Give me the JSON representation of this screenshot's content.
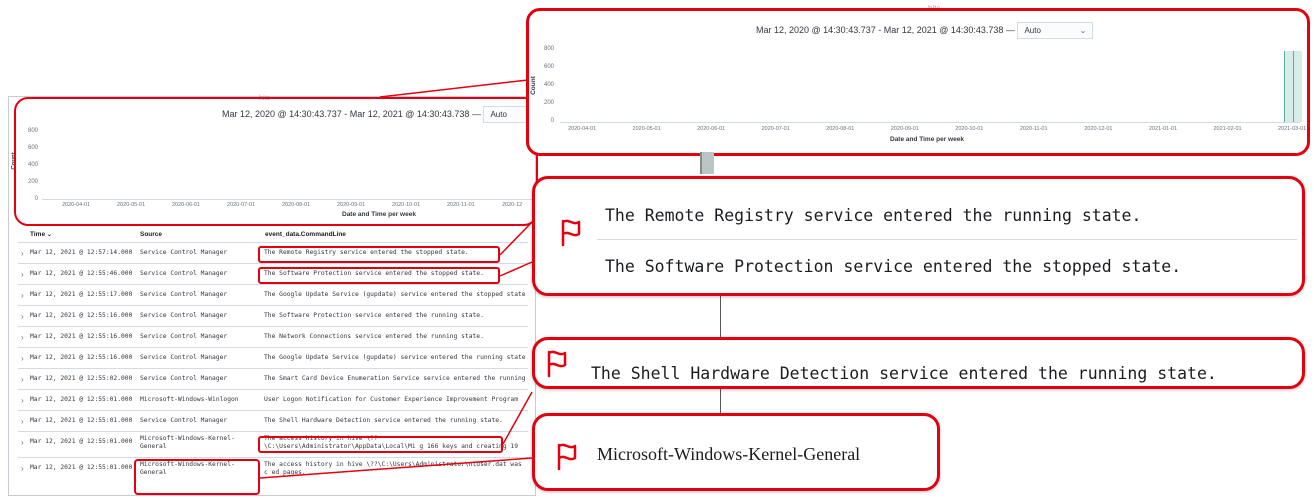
{
  "date_range": {
    "text": "Mar 12, 2020 @ 14:30:43.737 - Mar 12, 2021 @ 14:30:43.738 —",
    "interval": "Auto"
  },
  "chart_label_top": "hits",
  "chart_data": {
    "type": "bar",
    "xlabel": "Date and Time per week",
    "ylabel": "Count",
    "ylim": [
      0,
      800
    ],
    "y_ticks": [
      "800",
      "600",
      "400",
      "200",
      "0"
    ],
    "x_ticks_large": [
      "2020-04-01",
      "2020-05-01",
      "2020-06-01",
      "2020-07-01",
      "2020-08-01",
      "2020-09-01",
      "2020-10-01",
      "2020-11-01",
      "2020-12-01",
      "2021-01-01",
      "2021-02-01",
      "2021-03-01"
    ],
    "x_ticks_small": [
      "2020-04-01",
      "2020-05-01",
      "2020-06-01",
      "2020-07-01",
      "2020-08-01",
      "2020-09-01",
      "2020-10-01",
      "2020-11-01",
      "2020-12"
    ],
    "categories": [
      "2021-03-08"
    ],
    "values": [
      730
    ],
    "grid": false,
    "colors": {
      "bar": "#d6ece8",
      "bar_edge": "#54b399"
    }
  },
  "table": {
    "columns": [
      "Time",
      "Source",
      "event_data.CommandLine"
    ],
    "sort_icon": "sort-down-icon",
    "rows": [
      {
        "time": "Mar 12, 2021 @ 12:57:14.000",
        "source": "Service Control Manager",
        "cmd": "The Remote Registry service entered the stopped state."
      },
      {
        "time": "Mar 12, 2021 @ 12:55:46.000",
        "source": "Service Control Manager",
        "cmd": "The Software Protection service entered the stopped state."
      },
      {
        "time": "Mar 12, 2021 @ 12:55:17.000",
        "source": "Service Control Manager",
        "cmd": "The Google Update Service (gupdate) service entered the stopped state"
      },
      {
        "time": "Mar 12, 2021 @ 12:55:16.000",
        "source": "Service Control Manager",
        "cmd": "The Software Protection service entered the running state."
      },
      {
        "time": "Mar 12, 2021 @ 12:55:16.000",
        "source": "Service Control Manager",
        "cmd": "The Network Connections service entered the running state."
      },
      {
        "time": "Mar 12, 2021 @ 12:55:16.000",
        "source": "Service Control Manager",
        "cmd": "The Google Update Service (gupdate) service entered the running state"
      },
      {
        "time": "Mar 12, 2021 @ 12:55:02.000",
        "source": "Service Control Manager",
        "cmd": "The Smart Card Device Enumeration Service service entered the running"
      },
      {
        "time": "Mar 12, 2021 @ 12:55:01.000",
        "source": "Microsoft-Windows-Winlogon",
        "cmd": "User Logon Notification for Customer Experience Improvement Program"
      },
      {
        "time": "Mar 12, 2021 @ 12:55:01.000",
        "source": "Service Control Manager",
        "cmd": "The Shell Hardware Detection service entered the running state."
      },
      {
        "time": "Mar 12, 2021 @ 12:55:01.000",
        "source": "Microsoft-Windows-Kernel-General",
        "cmd": "The access history in hive \\??\\C:\\Users\\Administrator\\AppData\\Local\\Mi g 166 keys and creating 19 modified pages."
      },
      {
        "time": "Mar 12, 2021 @ 12:55:01.000",
        "source": "Microsoft-Windows-Kernel-General",
        "cmd": "The access history in hive \\??\\C:\\Users\\Administrator\\ntuser.dat was c ed pages."
      }
    ]
  },
  "callouts": {
    "registry": "The Remote Registry service entered the running state.",
    "protection": "The Software Protection service entered the stopped state.",
    "shell": "The Shell Hardware Detection service entered the running state.",
    "kernel": "Microsoft-Windows-Kernel-General",
    "flag_icon": "flag-icon"
  },
  "colors": {
    "highlight": "#e3000f",
    "bar": "#d6ece8"
  }
}
